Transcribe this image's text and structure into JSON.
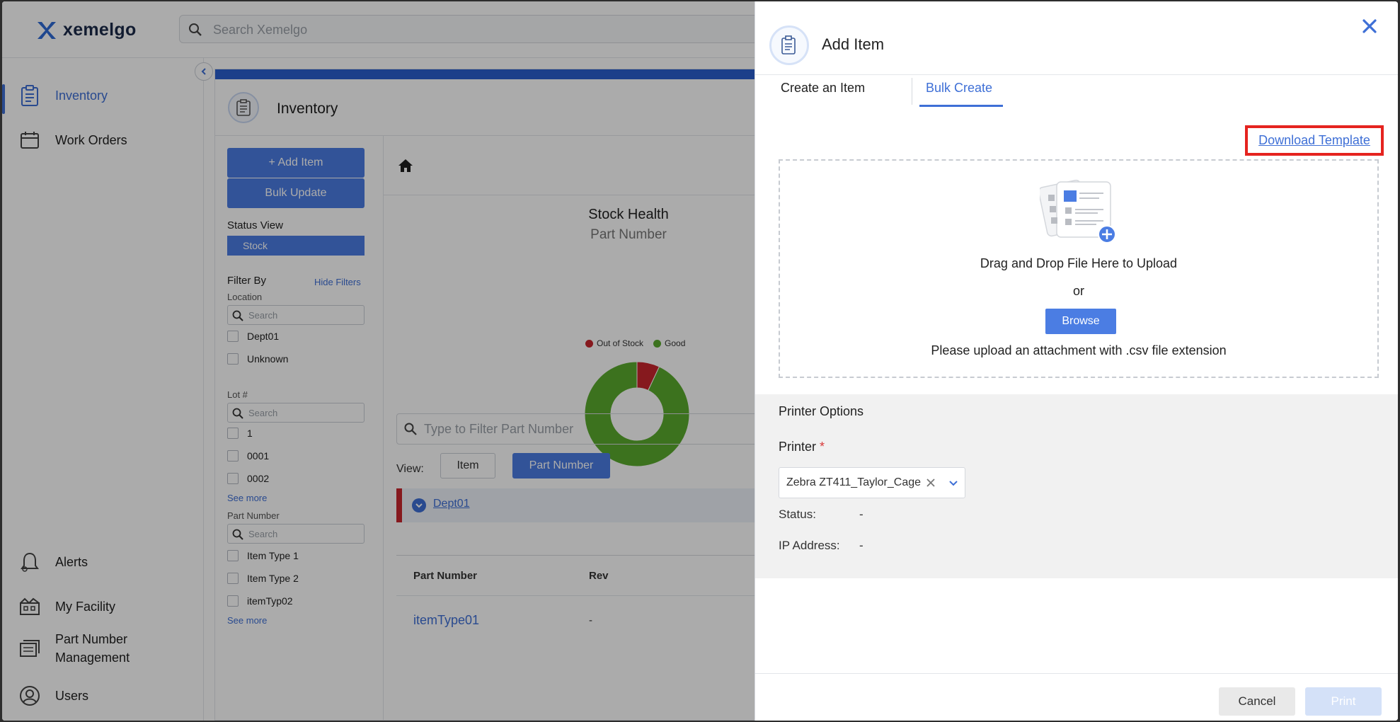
{
  "app": {
    "brand": "xemelgo",
    "accent": "#3e6fd6"
  },
  "search": {
    "placeholder": "Search Xemelgo"
  },
  "sidebar": {
    "items": [
      {
        "label": "Inventory",
        "icon": "clipboard-icon",
        "active": true
      },
      {
        "label": "Work Orders",
        "icon": "calendar-icon"
      },
      {
        "label": "Alerts",
        "icon": "bell-icon"
      },
      {
        "label": "My Facility",
        "icon": "facility-icon"
      },
      {
        "label": "Part Number",
        "label2": "Management",
        "icon": "part-management-icon"
      },
      {
        "label": "Users",
        "icon": "user-icon"
      }
    ]
  },
  "inventory": {
    "title": "Inventory",
    "add_item": "+ Add Item",
    "bulk_update": "Bulk Update",
    "status_view": "Status View",
    "stock": "Stock",
    "filter_by": "Filter By",
    "hide_filters": "Hide Filters",
    "location_label": "Location",
    "location_search": "Search",
    "locations": [
      "Dept01",
      "Unknown"
    ],
    "lot_label": "Lot #",
    "lot_search": "Search",
    "lots": [
      "1",
      "0001",
      "0002"
    ],
    "see_more_1": "See more",
    "part_label": "Part Number",
    "part_search": "Search",
    "parts": [
      "Item Type 1",
      "Item Type 2",
      "itemTyp02"
    ],
    "see_more_2": "See more",
    "filter_placeholder": "Type to Filter Part Number",
    "view_label": "View:",
    "view_item": "Item",
    "view_part": "Part Number",
    "group": "Dept01",
    "table": {
      "headers": [
        "Part Number",
        "Rev"
      ],
      "rows": [
        [
          "itemType01",
          "-"
        ]
      ]
    }
  },
  "chart_data": {
    "type": "pie",
    "title": "Stock Health",
    "subtitle": "Part Number",
    "categories": [
      "Out of Stock",
      "Good"
    ],
    "values": [
      7,
      93
    ],
    "colors": [
      "#c8262d",
      "#5aaa2e"
    ],
    "legend": "top"
  },
  "modal": {
    "title": "Add Item",
    "tabs": [
      "Create an Item",
      "Bulk Create"
    ],
    "active_tab": "Bulk Create",
    "download_template": "Download Template",
    "drop_text": "Drag and Drop File Here to Upload",
    "or": "or",
    "browse": "Browse",
    "hint": "Please upload an attachment with .csv file extension",
    "printer_options": "Printer Options",
    "printer_label": "Printer",
    "required": "*",
    "printer_value": "Zebra ZT411_Taylor_Cage",
    "status_label": "Status:",
    "status_value": "-",
    "ip_label": "IP Address:",
    "ip_value": "-",
    "cancel": "Cancel",
    "print": "Print"
  }
}
